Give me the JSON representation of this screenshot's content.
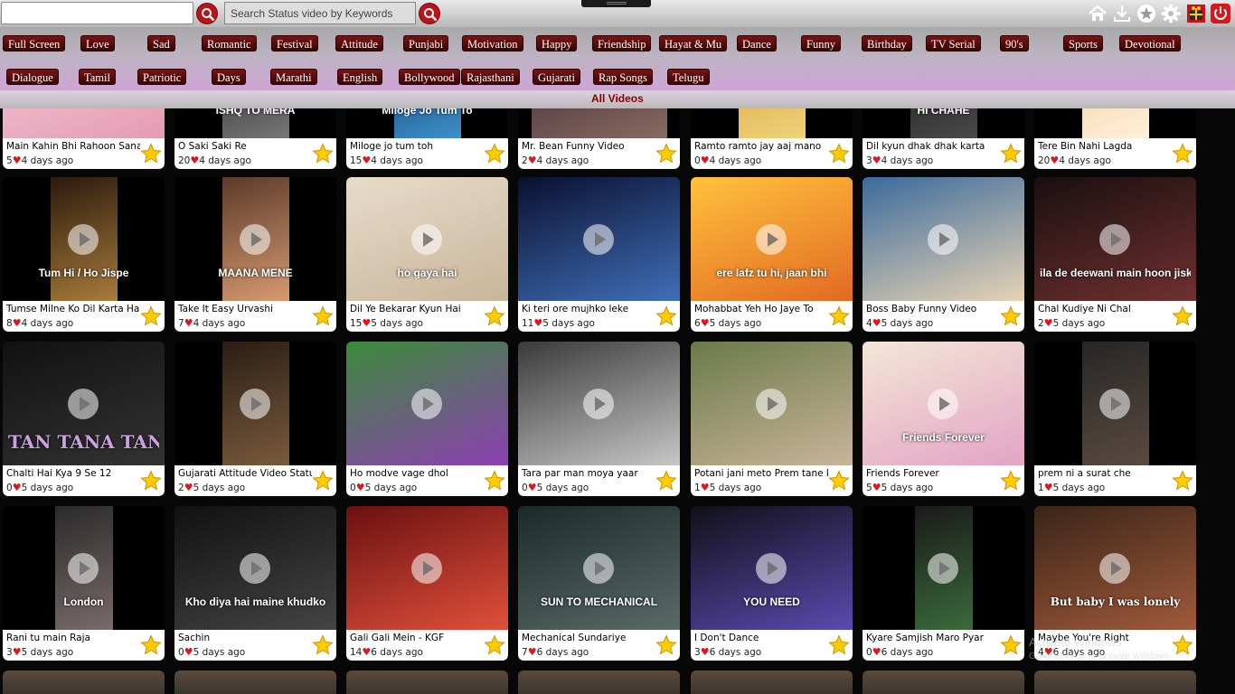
{
  "colors": {
    "accent": "#8b0000",
    "category_bg": "#5a0a0a",
    "search_btn": "#b8151b",
    "heart": "#e0161e",
    "star": "#ffcc00"
  },
  "header": {
    "search_value": "",
    "video_search_placeholder": "Search Status video by Keywords",
    "icons": [
      "home-icon",
      "download-icon",
      "favorite-icon",
      "settings-icon",
      "gift-icon",
      "power-icon"
    ]
  },
  "categories": [
    "Full Screen",
    "Love",
    "Sad",
    "Romantic",
    "Festival",
    "Attitude",
    "Punjabi",
    "Motivation",
    "Happy",
    "Friendship",
    "Hayat & Mu",
    "Dance",
    "Funny",
    "Birthday",
    "TV Serial",
    "90's",
    "Sports",
    "Devotional",
    "Dialogue",
    "Tamil",
    "Patriotic",
    "Days",
    "Marathi",
    "English",
    "Bollywood",
    "Rajasthani",
    "Gujarati",
    "Rap Songs",
    "Telugu"
  ],
  "section_title": "All Videos",
  "videos": [
    {
      "title": "Main Kahin Bhi Rahoon Sanam",
      "likes": "5",
      "age": "4 days ago",
      "overlay": ""
    },
    {
      "title": "O Saki Saki Re",
      "likes": "20",
      "age": "4 days ago",
      "overlay": "ISHQ TO MERA"
    },
    {
      "title": "Miloge jo tum toh",
      "likes": "15",
      "age": "4 days ago",
      "overlay": "Miloge Jo Tum To"
    },
    {
      "title": "Mr. Bean Funny Video",
      "likes": "2",
      "age": "4 days ago",
      "overlay": ""
    },
    {
      "title": "Ramto ramto jay aaj mano",
      "likes": "0",
      "age": "4 days ago",
      "overlay": ""
    },
    {
      "title": "Dil kyun dhak dhak karta",
      "likes": "3",
      "age": "4 days ago",
      "overlay": "HI CHAHE"
    },
    {
      "title": "Tere Bin Nahi Lagda",
      "likes": "20",
      "age": "4 days ago",
      "overlay": ""
    },
    {
      "title": "Tumse Milne Ko Dil Karta Hai",
      "likes": "8",
      "age": "4 days ago",
      "overlay": "Tum Hi / Ho Jispe"
    },
    {
      "title": "Take It Easy Urvashi",
      "likes": "7",
      "age": "4 days ago",
      "overlay": "MAANA MENE"
    },
    {
      "title": "Dil Ye Bekarar Kyun Hai",
      "likes": "15",
      "age": "5 days ago",
      "overlay": "ho gaya hai"
    },
    {
      "title": "Ki teri ore mujhko leke",
      "likes": "11",
      "age": "5 days ago",
      "overlay": ""
    },
    {
      "title": "Mohabbat Yeh Ho Jaye To",
      "likes": "6",
      "age": "5 days ago",
      "overlay": "ere lafz tu hi, jaan bhi"
    },
    {
      "title": "Boss Baby Funny Video",
      "likes": "4",
      "age": "5 days ago",
      "overlay": ""
    },
    {
      "title": "Chal Kudiye Ni Chal",
      "likes": "2",
      "age": "5 days ago",
      "overlay": "ila de deewani main hoon jisk"
    },
    {
      "title": "Chalti Hai Kya 9 Se 12",
      "likes": "0",
      "age": "5 days ago",
      "overlay": "TAN TANA TAN"
    },
    {
      "title": "Gujarati Attitude Video Status",
      "likes": "2",
      "age": "5 days ago",
      "overlay": ""
    },
    {
      "title": "Ho modve vage dhol",
      "likes": "0",
      "age": "5 days ago",
      "overlay": ""
    },
    {
      "title": "Tara par man moya yaar",
      "likes": "0",
      "age": "5 days ago",
      "overlay": ""
    },
    {
      "title": "Potani jani meto Prem tane karyo",
      "likes": "1",
      "age": "5 days ago",
      "overlay": ""
    },
    {
      "title": "Friends Forever",
      "likes": "5",
      "age": "5 days ago",
      "overlay": "Friends Forever"
    },
    {
      "title": "prem ni a surat che",
      "likes": "1",
      "age": "5 days ago",
      "overlay": ""
    },
    {
      "title": "Rani tu main Raja",
      "likes": "3",
      "age": "5 days ago",
      "overlay": "London"
    },
    {
      "title": "Sachin",
      "likes": "0",
      "age": "5 days ago",
      "overlay": "Kho diya hai maine khudko"
    },
    {
      "title": "Gali Gali Mein - KGF",
      "likes": "14",
      "age": "6 days ago",
      "overlay": ""
    },
    {
      "title": "Mechanical Sundariye",
      "likes": "7",
      "age": "6 days ago",
      "overlay": "SUN TO MECHANICAL"
    },
    {
      "title": "I Don't Dance",
      "likes": "3",
      "age": "6 days ago",
      "overlay": "YOU NEED"
    },
    {
      "title": "Kyare Samjish Maro Pyar",
      "likes": "0",
      "age": "6 days ago",
      "overlay": ""
    },
    {
      "title": "Maybe You're Right",
      "likes": "4",
      "age": "6 days ago",
      "overlay": "But baby I was lonely"
    }
  ],
  "watermark": {
    "line1": "Activate Windows",
    "line2": "Go to Settings to activate Windows."
  }
}
